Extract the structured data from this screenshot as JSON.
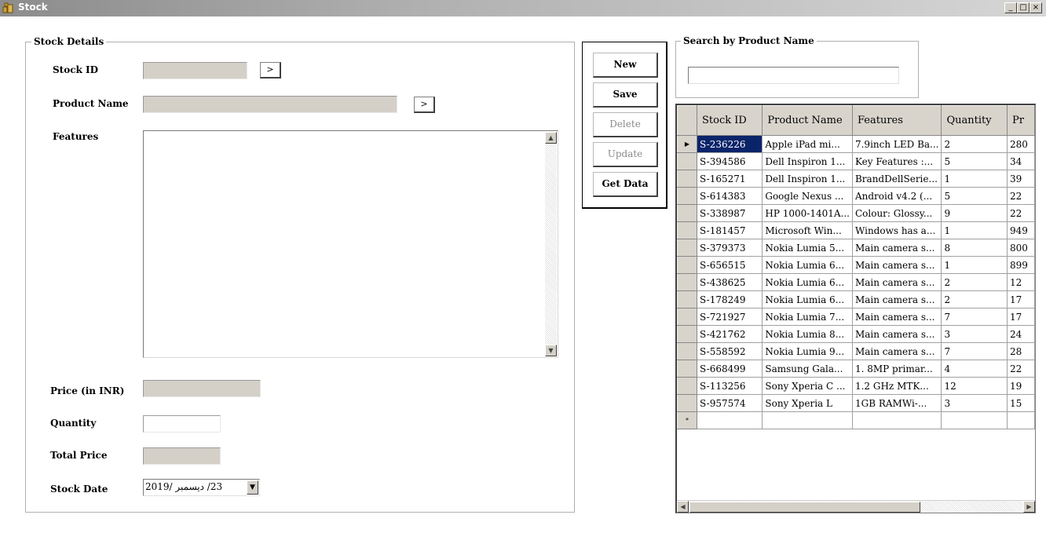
{
  "window": {
    "title": "Stock",
    "controls": {
      "minimize": "_",
      "maximize": "□",
      "close": "×"
    },
    "icon": "stock-app-icon"
  },
  "stock_details": {
    "legend": "Stock Details",
    "stock_id_label": "Stock ID",
    "product_name_label": "Product Name",
    "features_label": "Features",
    "price_label": "Price (in INR)",
    "quantity_label": "Quantity",
    "total_price_label": "Total Price",
    "stock_date_label": "Stock Date",
    "arrow_button": ">",
    "stock_date_value": "23/ دیسمبر /2019"
  },
  "actions": {
    "new": "New",
    "save": "Save",
    "delete": "Delete",
    "update": "Update",
    "get_data": "Get Data"
  },
  "search": {
    "legend": "Search by Product Name",
    "value": ""
  },
  "grid": {
    "columns": [
      "Stock ID",
      "Product Name",
      "Features",
      "Quantity",
      "Pr"
    ],
    "rows": [
      [
        "S-236226",
        "Apple iPad mi...",
        "7.9inch LED Ba...",
        "2",
        "280"
      ],
      [
        "S-394586",
        "Dell Inspiron 1...",
        "Key Features :...",
        "5",
        "34"
      ],
      [
        "S-165271",
        "Dell Inspiron 1...",
        "BrandDellSerie...",
        "1",
        "39"
      ],
      [
        "S-614383",
        "Google Nexus ...",
        "Android v4.2 (...",
        "5",
        "22"
      ],
      [
        "S-338987",
        "HP 1000-1401A...",
        "Colour: Glossy...",
        "9",
        "22"
      ],
      [
        "S-181457",
        "Microsoft Win...",
        "Windows has a...",
        "1",
        "949"
      ],
      [
        "S-379373",
        "Nokia Lumia 5...",
        "Main camera s...",
        "8",
        "800"
      ],
      [
        "S-656515",
        "Nokia Lumia 6...",
        "Main camera s...",
        "1",
        "899"
      ],
      [
        "S-438625",
        "Nokia Lumia 6...",
        "Main camera s...",
        "2",
        "12"
      ],
      [
        "S-178249",
        "Nokia Lumia 6...",
        "Main camera s...",
        "2",
        "17"
      ],
      [
        "S-721927",
        "Nokia Lumia 7...",
        "Main camera s...",
        "7",
        "17"
      ],
      [
        "S-421762",
        "Nokia Lumia 8...",
        "Main camera s...",
        "3",
        "24"
      ],
      [
        "S-558592",
        "Nokia Lumia 9...",
        "Main camera s...",
        "7",
        "28"
      ],
      [
        "S-668499",
        "Samsung Gala...",
        "1. 8MP primar...",
        "4",
        "22"
      ],
      [
        "S-113256",
        "Sony Xperia C ...",
        "1.2 GHz MTK...",
        "12",
        "19"
      ],
      [
        "S-957574",
        "Sony Xperia L",
        "1GB RAMWi-...",
        "3",
        "15"
      ]
    ],
    "selected_row": 0,
    "current_row_marker": "▶",
    "new_row_marker": "*"
  },
  "colors": {
    "selection": "#0a246a",
    "disabled_field": "#d4d0c8"
  }
}
